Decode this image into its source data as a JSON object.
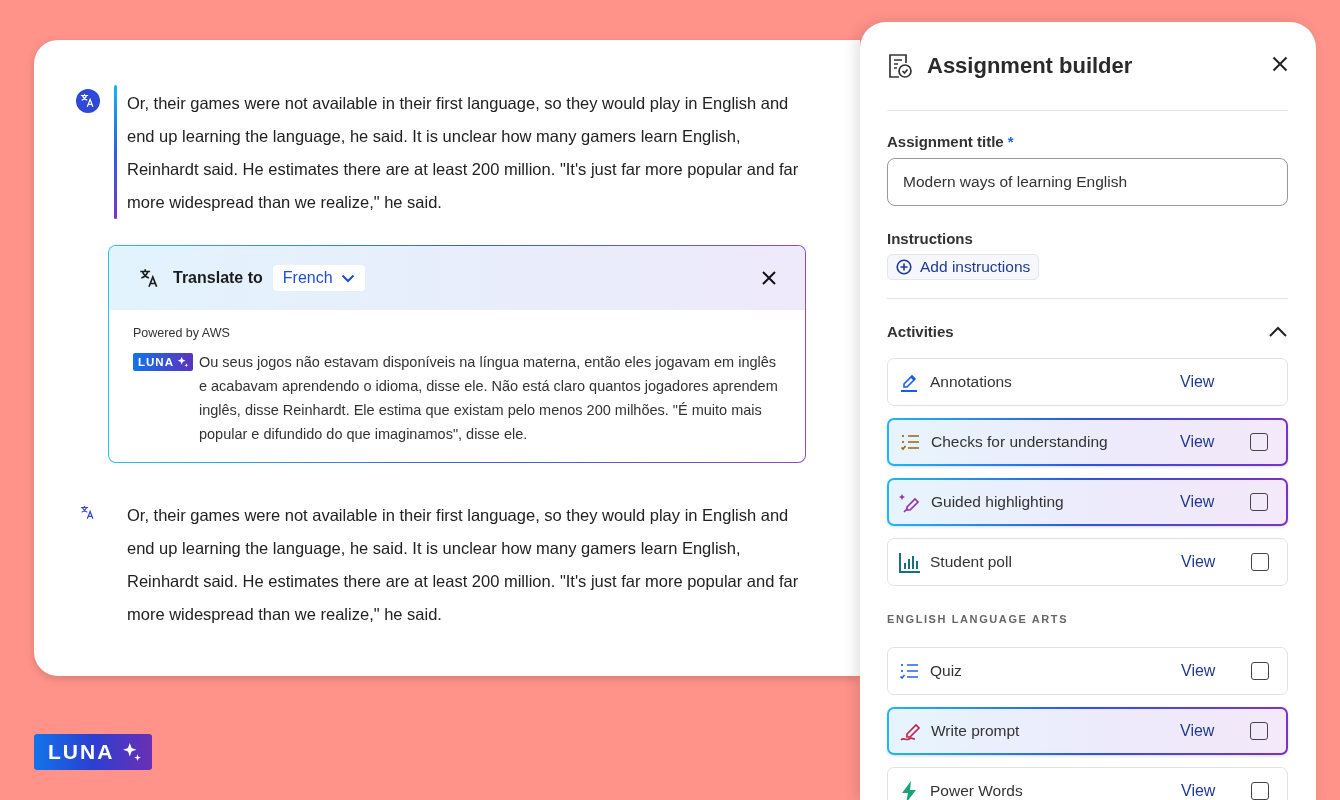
{
  "reader": {
    "paragraphs": [
      {
        "selected": true,
        "text": "Or, their games were not available in their first language, so they would play in English and end up learning the language, he said. It is unclear how many gamers learn English, Reinhardt said. He estimates there are at least 200 million. \"It's just far more popular and far more widespread than we realize,\" he said."
      },
      {
        "selected": false,
        "text": "Or, their games were not available in their first language, so they would play in English and end up learning the language, he said. It is unclear how many gamers learn English, Reinhardt said. He estimates there are at least 200 million. \"It's just far more popular and far more widespread than we realize,\" he said."
      }
    ],
    "translation": {
      "label": "Translate to",
      "language": "French",
      "powered_by": "Powered by AWS",
      "badge": "LUNA",
      "text": "Ou seus jogos não estavam disponíveis na língua materna, então eles jogavam em inglês e acabavam aprendendo o idioma, disse ele. Não está claro quantos jogadores aprendem inglês, disse Reinhardt. Ele estima que existam pelo menos 200 milhões. \"É muito mais popular e difundido do que imaginamos\", disse ele."
    }
  },
  "panel": {
    "title": "Assignment builder",
    "title_label": "Assignment title",
    "required_mark": "*",
    "title_value": "Modern ways of learning English",
    "instructions_label": "Instructions",
    "add_instructions": "Add instructions",
    "activities": {
      "label": "Activities",
      "expanded": true,
      "items": [
        {
          "kind": "annotation",
          "label": "Annotations",
          "action": "View",
          "highlighted": false
        },
        {
          "kind": "checklist",
          "label": "Checks for understanding",
          "action": "View",
          "highlighted": true,
          "checked": false
        },
        {
          "kind": "sparkle-pen",
          "label": "Guided highlighting",
          "action": "View",
          "highlighted": true,
          "checked": false
        },
        {
          "kind": "poll",
          "label": "Student poll",
          "action": "View",
          "highlighted": false,
          "checked": false
        }
      ]
    },
    "section": {
      "label": "ENGLISH LANGUAGE ARTS",
      "items": [
        {
          "kind": "list",
          "label": "Quiz",
          "action": "View",
          "highlighted": false,
          "checked": false
        },
        {
          "kind": "pen",
          "label": "Write prompt",
          "action": "View",
          "highlighted": true,
          "checked": false
        },
        {
          "kind": "bolt",
          "label": "Power Words",
          "action": "View",
          "highlighted": false,
          "checked": false
        }
      ]
    }
  },
  "brand_badge": "LUNA"
}
